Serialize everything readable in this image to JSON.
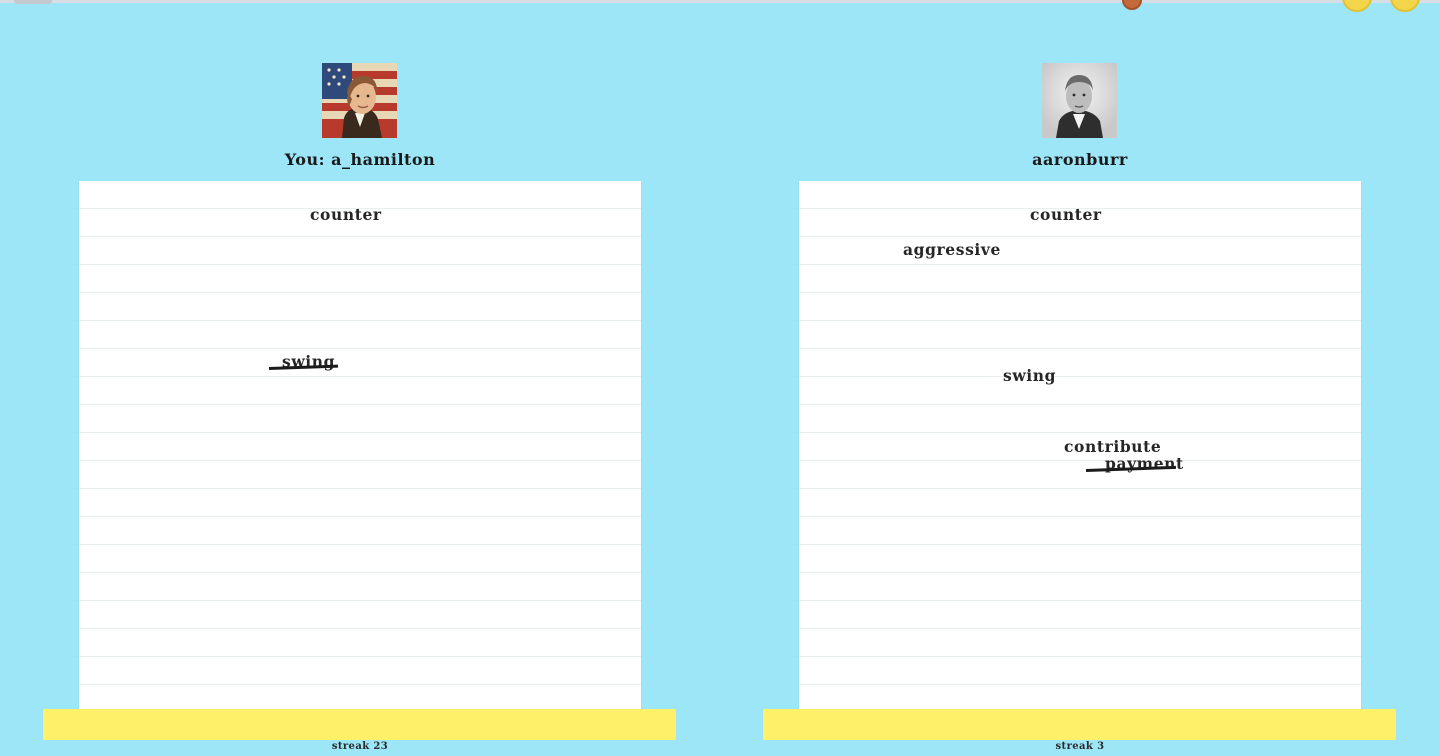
{
  "game": {
    "colors": {
      "background": "#9ce6f8",
      "paper": "#ffffff",
      "input_bar": "#fff06a",
      "text": "#262626"
    },
    "players": [
      {
        "label": "You: a_hamilton",
        "avatar_icon": "hamilton-portrait-icon",
        "words": [
          {
            "text": "counter",
            "crossed": false
          },
          {
            "text": "swing",
            "crossed": true
          }
        ],
        "streak": "streak 23"
      },
      {
        "label": "aaronburr",
        "avatar_icon": "burr-portrait-icon",
        "words": [
          {
            "text": "counter",
            "crossed": false
          },
          {
            "text": "aggressive",
            "crossed": false
          },
          {
            "text": "swing",
            "crossed": false
          },
          {
            "text": "contribute",
            "crossed": false
          },
          {
            "text": "payment",
            "crossed": true
          }
        ],
        "streak": "streak 3"
      }
    ]
  }
}
